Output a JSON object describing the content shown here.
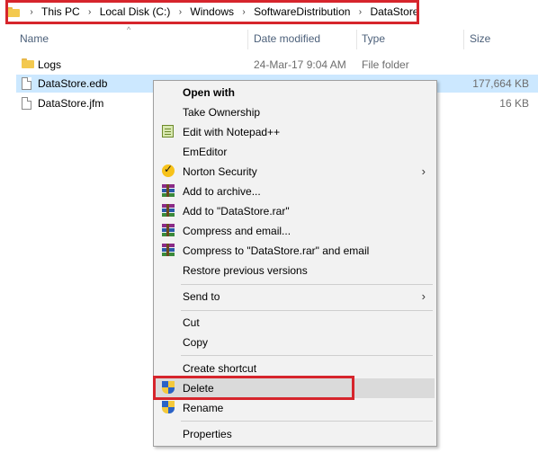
{
  "breadcrumb": {
    "items": [
      "This PC",
      "Local Disk (C:)",
      "Windows",
      "SoftwareDistribution",
      "DataStore"
    ],
    "separator": "›"
  },
  "columns": {
    "name": "Name",
    "date": "Date modified",
    "type": "Type",
    "size": "Size",
    "sort_indicator": "^"
  },
  "files": [
    {
      "name": "Logs",
      "date": "24-Mar-17 9:04 AM",
      "type": "File folder",
      "size": "",
      "icon": "folder-icon"
    },
    {
      "name": "DataStore.edb",
      "date": "",
      "type": "",
      "size": "177,664 KB",
      "icon": "file-icon"
    },
    {
      "name": "DataStore.jfm",
      "date": "",
      "type": "",
      "size": "16 KB",
      "icon": "file-icon"
    }
  ],
  "context_menu": {
    "items": [
      {
        "label": "Open with",
        "icon": "",
        "bold": true
      },
      {
        "label": "Take Ownership",
        "icon": ""
      },
      {
        "label": "Edit with Notepad++",
        "icon": "notepad-icon"
      },
      {
        "label": "EmEditor",
        "icon": ""
      },
      {
        "label": "Norton Security",
        "icon": "norton-icon",
        "submenu": true
      },
      {
        "label": "Add to archive...",
        "icon": "winrar-icon"
      },
      {
        "label": "Add to \"DataStore.rar\"",
        "icon": "winrar-icon"
      },
      {
        "label": "Compress and email...",
        "icon": "winrar-icon"
      },
      {
        "label": "Compress to \"DataStore.rar\" and email",
        "icon": "winrar-icon"
      },
      {
        "label": "Restore previous versions",
        "icon": ""
      },
      {
        "label": "Send to",
        "icon": "",
        "submenu": true
      },
      {
        "label": "Cut",
        "icon": ""
      },
      {
        "label": "Copy",
        "icon": ""
      },
      {
        "label": "Create shortcut",
        "icon": ""
      },
      {
        "label": "Delete",
        "icon": "uac-shield-icon",
        "highlighted": true
      },
      {
        "label": "Rename",
        "icon": "uac-shield-icon"
      },
      {
        "label": "Properties",
        "icon": ""
      }
    ],
    "submenu_arrow": "›"
  },
  "colors": {
    "highlight_box": "#d6252c",
    "selected_row": "#cce8ff",
    "menu_bg": "#f2f2f2"
  }
}
